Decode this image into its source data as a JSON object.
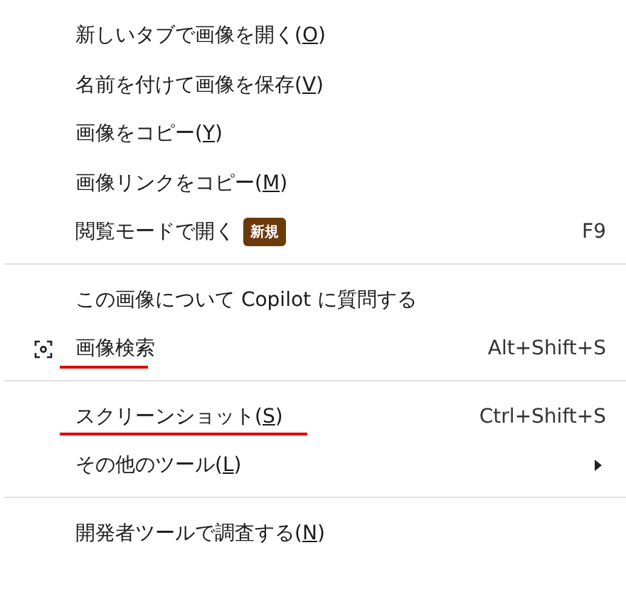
{
  "menu": {
    "groups": [
      {
        "items": [
          {
            "kind": "plain",
            "label": "新しいタブで画像を開く(",
            "mnemonic": "O",
            "label_end": ")"
          },
          {
            "kind": "plain",
            "label": "名前を付けて画像を保存(",
            "mnemonic": "V",
            "label_end": ")"
          },
          {
            "kind": "plain",
            "label": "画像をコピー(",
            "mnemonic": "Y",
            "label_end": ")"
          },
          {
            "kind": "plain",
            "label": "画像リンクをコピー(",
            "mnemonic": "M",
            "label_end": ")"
          },
          {
            "kind": "plain",
            "label": "閲覧モードで開く",
            "badge": "新規",
            "shortcut": "F9"
          }
        ]
      },
      {
        "items": [
          {
            "kind": "plain",
            "label": "この画像について Copilot に質問する"
          },
          {
            "kind": "search",
            "label": "画像検索",
            "shortcut": "Alt+Shift+S",
            "annotated": true
          }
        ]
      },
      {
        "items": [
          {
            "kind": "plain",
            "label": "スクリーンショット(",
            "mnemonic": "S",
            "label_end": ")",
            "shortcut": "Ctrl+Shift+S",
            "annotated": true
          },
          {
            "kind": "submenu",
            "label": "その他のツール(",
            "mnemonic": "L",
            "label_end": ")"
          }
        ]
      },
      {
        "items": [
          {
            "kind": "plain",
            "label": "開発者ツールで調査する(",
            "mnemonic": "N",
            "label_end": ")"
          }
        ]
      }
    ]
  }
}
